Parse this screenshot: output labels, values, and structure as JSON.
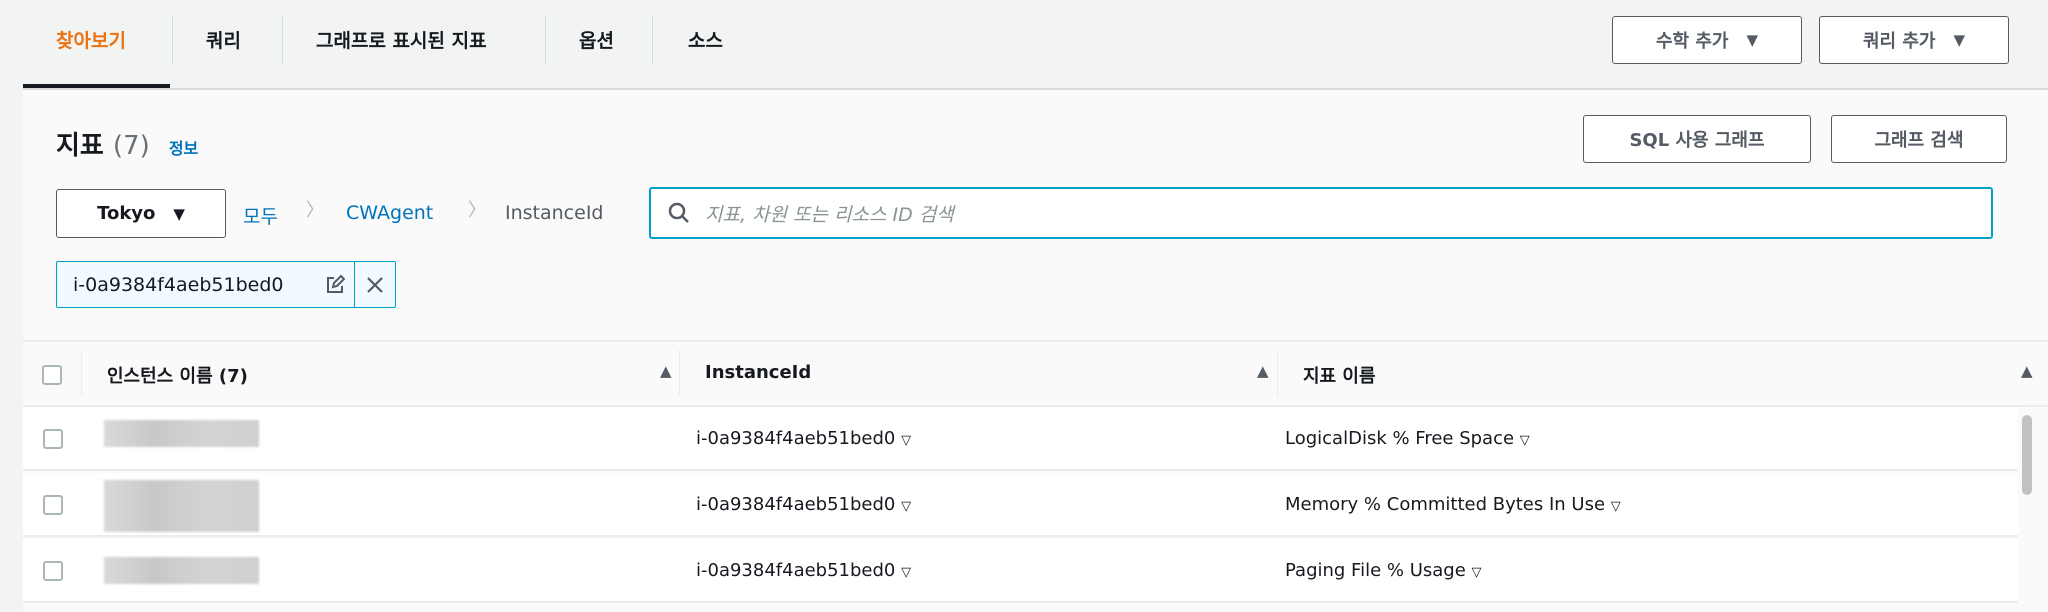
{
  "tabs": [
    {
      "label": "찾아보기",
      "active": true
    },
    {
      "label": "쿼리"
    },
    {
      "label": "그래프로 표시된 지표"
    },
    {
      "label": "옵션"
    },
    {
      "label": "소스"
    }
  ],
  "toolbar": {
    "add_math": "수학 추가",
    "add_query": "쿼리 추가"
  },
  "metrics": {
    "title": "지표",
    "count": "(7)",
    "info": "정보",
    "sql_graph": "SQL 사용 그래프",
    "graph_search": "그래프 검색"
  },
  "filter": {
    "region": "Tokyo",
    "breadcrumb": [
      "모두",
      "CWAgent",
      "InstanceId"
    ],
    "search_placeholder": "지표, 차원 또는 리소스 ID 검색",
    "token": "i-0a9384f4aeb51bed0"
  },
  "table": {
    "columns": [
      "인스턴스 이름 (7)",
      "InstanceId",
      "지표 이름"
    ],
    "rows": [
      {
        "instance_id": "i-0a9384f4aeb51bed0",
        "metric": "LogicalDisk % Free Space"
      },
      {
        "instance_id": "i-0a9384f4aeb51bed0",
        "metric": "Memory % Committed Bytes In Use"
      },
      {
        "instance_id": "i-0a9384f4aeb51bed0",
        "metric": "Paging File % Usage"
      }
    ]
  },
  "colors": {
    "accent": "#ec7211",
    "link": "#0073bb",
    "focus": "#00a1c9"
  }
}
